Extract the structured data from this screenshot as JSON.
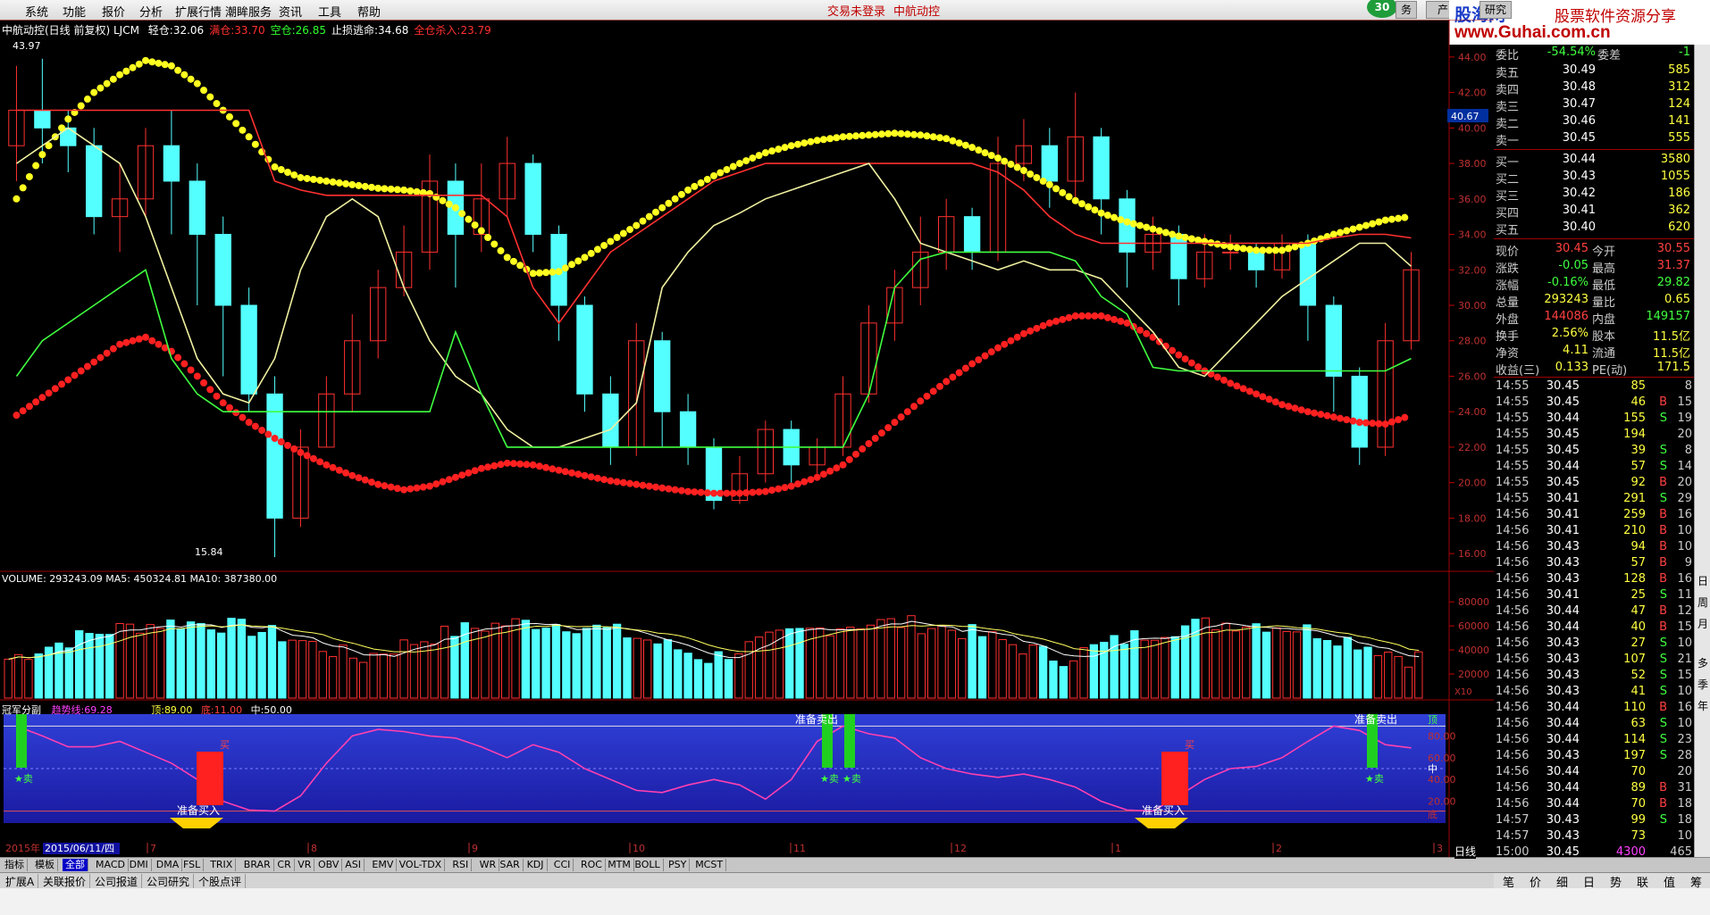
{
  "menu": [
    "系统",
    "功能",
    "报价",
    "分析",
    "扩展行情",
    "潮眸服务",
    "资讯",
    "工具",
    "帮助"
  ],
  "login_status": "交易未登录",
  "stock_name_top": "中航动控",
  "badge": "30",
  "top_buttons": [
    "务",
    "产品",
    "研究"
  ],
  "logo": {
    "name": "股海网",
    "slogan": "股票软件资源分享",
    "url": "www.Guhai.com.cn"
  },
  "chart_title": {
    "name": "中航动控(日线 前复权) LJCM",
    "items": [
      {
        "label": "轻仓:",
        "value": "32.06",
        "color": "#ffffff"
      },
      {
        "label": "满仓:",
        "value": "33.70",
        "color": "#ff3030"
      },
      {
        "label": "空仓:",
        "value": "26.85",
        "color": "#30ff30"
      },
      {
        "label": "止损逃命:",
        "value": "34.68",
        "color": "#ffffff"
      },
      {
        "label": "全仓杀入:",
        "value": "23.79",
        "color": "#ff3030"
      }
    ]
  },
  "price_axis": [
    "44.00",
    "42.00",
    "40.00",
    "38.00",
    "36.00",
    "34.00",
    "32.00",
    "30.00",
    "28.00",
    "26.00",
    "24.00",
    "22.00",
    "20.00",
    "18.00",
    "16.00"
  ],
  "price_flag": "40.67",
  "high_label": "43.97",
  "low_label": "15.84",
  "volume_title": "VOLUME: 293243.09  MA5: 450324.81  MA10: 387380.00",
  "volume_axis": [
    "80000",
    "60000",
    "40000",
    "20000"
  ],
  "volume_unit": "X10",
  "indicator_title": {
    "name": "冠军分副",
    "trend_label": "趋势线:",
    "trend": "69.28",
    "top_label": "顶:",
    "top": "89.00",
    "bottom_label": "底:",
    "bottom": "11.00",
    "mid_label": "中:",
    "mid": "50.00"
  },
  "ind_axis": [
    "顶",
    "80.00",
    "60.00",
    "中",
    "40.00",
    "20.00",
    "底"
  ],
  "ind_signals": {
    "sell": "准备卖出",
    "buy": "准备买入",
    "star_sell": "★卖",
    "buy_mark": "买"
  },
  "date_axis": {
    "year": "2015年",
    "date": "2015/06/11/四",
    "months": [
      "7",
      "8",
      "9",
      "10",
      "11",
      "12",
      "1",
      "2",
      "3"
    ]
  },
  "period": "日线",
  "tabs": [
    "指标",
    "模板",
    "全部",
    "MACD",
    "DMI",
    "DMA",
    "FSL",
    "TRIX",
    "BRAR",
    "CR",
    "VR",
    "OBV",
    "ASI",
    "EMV",
    "VOL-TDX",
    "RSI",
    "WR",
    "SAR",
    "KDJ",
    "CCI",
    "ROC",
    "MTM",
    "BOLL",
    "PSY",
    "MCST"
  ],
  "tab_active": "全部",
  "bottom_tabs": [
    "扩展A",
    "关联报价",
    "公司报道",
    "公司研究",
    "个股点评"
  ],
  "right_panel": {
    "ratio": {
      "l1": "委比",
      "v1": "-54.54%",
      "l2": "委差",
      "v2": "-1"
    },
    "asks": [
      {
        "label": "卖五",
        "price": "30.49",
        "vol": "585"
      },
      {
        "label": "卖四",
        "price": "30.48",
        "vol": "312"
      },
      {
        "label": "卖三",
        "price": "30.47",
        "vol": "124"
      },
      {
        "label": "卖二",
        "price": "30.46",
        "vol": "141"
      },
      {
        "label": "卖一",
        "price": "30.45",
        "vol": "555"
      }
    ],
    "bids": [
      {
        "label": "买一",
        "price": "30.44",
        "vol": "3580"
      },
      {
        "label": "买二",
        "price": "30.43",
        "vol": "1055"
      },
      {
        "label": "买三",
        "price": "30.42",
        "vol": "186"
      },
      {
        "label": "买四",
        "price": "30.41",
        "vol": "362"
      },
      {
        "label": "买五",
        "price": "30.40",
        "vol": "620"
      }
    ],
    "stats": [
      {
        "l1": "现价",
        "v1": "30.45",
        "c1": "#ff4040",
        "l2": "今开",
        "v2": "30.55",
        "c2": "#ff4040"
      },
      {
        "l1": "涨跌",
        "v1": "-0.05",
        "c1": "#40ff40",
        "l2": "最高",
        "v2": "31.37",
        "c2": "#ff4040"
      },
      {
        "l1": "涨幅",
        "v1": "-0.16%",
        "c1": "#40ff40",
        "l2": "最低",
        "v2": "29.82",
        "c2": "#40ff40"
      },
      {
        "l1": "总量",
        "v1": "293243",
        "c1": "#ffff40",
        "l2": "量比",
        "v2": "0.65",
        "c2": "#ffff40"
      },
      {
        "l1": "外盘",
        "v1": "144086",
        "c1": "#ff4040",
        "l2": "内盘",
        "v2": "149157",
        "c2": "#40ff40"
      },
      {
        "l1": "换手",
        "v1": "2.56%",
        "c1": "#ffff40",
        "l2": "股本",
        "v2": "11.5亿",
        "c2": "#ffff40"
      },
      {
        "l1": "净资",
        "v1": "4.11",
        "c1": "#ffff40",
        "l2": "流通",
        "v2": "11.5亿",
        "c2": "#ffff40"
      },
      {
        "l1": "收益(三)",
        "v1": "0.133",
        "c1": "#ffff40",
        "l2": "PE(动)",
        "v2": "171.5",
        "c2": "#ffff40"
      }
    ],
    "ticks": [
      {
        "t": "14:55",
        "p": "30.45",
        "v": "85",
        "s": "",
        "n": "8"
      },
      {
        "t": "14:55",
        "p": "30.45",
        "v": "46",
        "s": "B",
        "n": "15"
      },
      {
        "t": "14:55",
        "p": "30.44",
        "v": "155",
        "s": "S",
        "n": "19"
      },
      {
        "t": "14:55",
        "p": "30.45",
        "v": "194",
        "s": "",
        "n": "20"
      },
      {
        "t": "14:55",
        "p": "30.45",
        "v": "39",
        "s": "S",
        "n": "8"
      },
      {
        "t": "14:55",
        "p": "30.44",
        "v": "57",
        "s": "S",
        "n": "14"
      },
      {
        "t": "14:55",
        "p": "30.45",
        "v": "92",
        "s": "B",
        "n": "20"
      },
      {
        "t": "14:55",
        "p": "30.41",
        "v": "291",
        "s": "S",
        "n": "29"
      },
      {
        "t": "14:56",
        "p": "30.41",
        "v": "259",
        "s": "B",
        "n": "16"
      },
      {
        "t": "14:56",
        "p": "30.41",
        "v": "210",
        "s": "B",
        "n": "10"
      },
      {
        "t": "14:56",
        "p": "30.43",
        "v": "94",
        "s": "B",
        "n": "10"
      },
      {
        "t": "14:56",
        "p": "30.43",
        "v": "57",
        "s": "B",
        "n": "9"
      },
      {
        "t": "14:56",
        "p": "30.43",
        "v": "128",
        "s": "B",
        "n": "16"
      },
      {
        "t": "14:56",
        "p": "30.41",
        "v": "25",
        "s": "S",
        "n": "11"
      },
      {
        "t": "14:56",
        "p": "30.44",
        "v": "47",
        "s": "B",
        "n": "12"
      },
      {
        "t": "14:56",
        "p": "30.44",
        "v": "40",
        "s": "B",
        "n": "15"
      },
      {
        "t": "14:56",
        "p": "30.43",
        "v": "27",
        "s": "S",
        "n": "10"
      },
      {
        "t": "14:56",
        "p": "30.43",
        "v": "107",
        "s": "S",
        "n": "21"
      },
      {
        "t": "14:56",
        "p": "30.43",
        "v": "52",
        "s": "S",
        "n": "15"
      },
      {
        "t": "14:56",
        "p": "30.43",
        "v": "41",
        "s": "S",
        "n": "10"
      },
      {
        "t": "14:56",
        "p": "30.44",
        "v": "110",
        "s": "B",
        "n": "16"
      },
      {
        "t": "14:56",
        "p": "30.44",
        "v": "63",
        "s": "S",
        "n": "10"
      },
      {
        "t": "14:56",
        "p": "30.44",
        "v": "114",
        "s": "S",
        "n": "23"
      },
      {
        "t": "14:56",
        "p": "30.43",
        "v": "197",
        "s": "S",
        "n": "28"
      },
      {
        "t": "14:56",
        "p": "30.44",
        "v": "70",
        "s": "",
        "n": "20"
      },
      {
        "t": "14:56",
        "p": "30.44",
        "v": "89",
        "s": "B",
        "n": "31"
      },
      {
        "t": "14:56",
        "p": "30.44",
        "v": "70",
        "s": "B",
        "n": "18"
      },
      {
        "t": "14:57",
        "p": "30.43",
        "v": "99",
        "s": "S",
        "n": "18"
      },
      {
        "t": "14:57",
        "p": "30.43",
        "v": "73",
        "s": "",
        "n": "10"
      },
      {
        "t": "15:00",
        "p": "30.45",
        "v": "4300",
        "s": "",
        "n": "465"
      }
    ]
  },
  "right_vbar": [
    "日",
    "周",
    "月",
    "多",
    "季",
    "年"
  ],
  "right_bottom": [
    "笔",
    "价",
    "细",
    "日",
    "势",
    "联",
    "值",
    "筹"
  ],
  "chart_data": {
    "type": "candlestick",
    "y_range": [
      15,
      45
    ],
    "bull_color": "#ff3030",
    "bear_color": "#54ffff",
    "series": [
      {
        "kind": "dots",
        "color": "#ffff20",
        "values": [
          36,
          38.5,
          40.5,
          42,
          43,
          43.8,
          43.5,
          42.5,
          41,
          39.5,
          37.8,
          37.2,
          37,
          36.8,
          36.6,
          36.5,
          36.3,
          35.5,
          34.2,
          32.7,
          31.8,
          31.9,
          32.7,
          33.6,
          34.5,
          35.5,
          36.5,
          37.3,
          38,
          38.6,
          39,
          39.3,
          39.5,
          39.6,
          39.7,
          39.6,
          39.4,
          38.9,
          38.3,
          37.6,
          36.8,
          35.9,
          35.2,
          34.7,
          34.3,
          33.9,
          33.6,
          33.3,
          33.1,
          33.1,
          33.5,
          34,
          34.4,
          34.8,
          35
        ]
      },
      {
        "kind": "dots",
        "color": "#ff2020",
        "values": [
          23.8,
          24.8,
          25.8,
          26.8,
          27.8,
          28.2,
          27.4,
          26,
          24.5,
          23.4,
          22.5,
          21.7,
          21,
          20.4,
          19.9,
          19.6,
          19.8,
          20.3,
          20.8,
          21.1,
          21,
          20.7,
          20.4,
          20.1,
          19.9,
          19.7,
          19.5,
          19.4,
          19.4,
          19.5,
          19.8,
          20.3,
          21,
          22.2,
          23.4,
          24.6,
          25.7,
          26.7,
          27.6,
          28.4,
          29,
          29.4,
          29.4,
          29,
          28.2,
          27.2,
          26.3,
          25.6,
          25,
          24.4,
          24,
          23.7,
          23.4,
          23.3,
          23.8
        ]
      },
      {
        "kind": "line",
        "color": "#ff3030",
        "values": [
          41,
          41,
          41,
          41,
          41,
          41,
          41,
          41,
          41,
          41,
          37,
          36.5,
          36.2,
          36.2,
          36.2,
          36.2,
          36.2,
          36.2,
          36.2,
          35,
          31,
          29,
          31,
          33,
          34,
          35,
          36,
          37,
          37.5,
          38,
          38,
          38,
          38,
          38,
          38,
          38,
          38,
          38,
          37.5,
          36.5,
          35,
          34,
          33.5,
          33.5,
          33.5,
          33.5,
          33.5,
          33.5,
          33.5,
          33.5,
          33.5,
          33.8,
          34,
          34,
          33.8
        ]
      },
      {
        "kind": "line",
        "color": "#f0f0a0",
        "values": [
          38,
          39,
          40,
          39,
          38,
          35,
          31,
          27,
          25,
          24.5,
          27,
          32,
          35,
          36,
          35,
          31,
          28,
          26,
          25,
          23,
          22,
          22,
          22.5,
          23,
          24.5,
          31,
          33,
          34.5,
          35.2,
          36,
          36.5,
          37,
          37.5,
          38,
          36,
          33.5,
          33,
          32.5,
          32,
          32.5,
          32,
          32,
          31.5,
          30,
          28.5,
          26.5,
          26,
          27.5,
          29,
          30.5,
          31.5,
          32.5,
          33.5,
          33.5,
          32.2
        ]
      },
      {
        "kind": "line",
        "color": "#40ff40",
        "values": [
          26,
          28,
          29,
          30,
          31,
          32,
          27,
          25,
          24,
          24,
          24,
          24,
          24,
          24,
          24,
          24,
          24,
          28.5,
          25,
          22,
          22,
          22,
          22,
          22,
          22,
          22,
          22,
          22,
          22,
          22,
          22,
          22,
          22,
          25,
          31,
          32.6,
          33,
          33,
          33,
          33,
          33,
          32.5,
          30.5,
          29.5,
          26.5,
          26.3,
          26.3,
          26.3,
          26.3,
          26.3,
          26.3,
          26.3,
          26.3,
          26.3,
          27
        ]
      }
    ],
    "candles": [
      [
        39,
        41,
        43.5,
        37
      ],
      [
        41,
        40,
        43.9,
        38
      ],
      [
        40,
        39,
        41,
        37.5
      ],
      [
        39,
        35,
        40,
        34
      ],
      [
        35,
        36,
        38,
        33
      ],
      [
        36,
        39,
        40,
        35
      ],
      [
        39,
        37,
        41,
        34
      ],
      [
        37,
        34,
        38,
        30
      ],
      [
        34,
        30,
        35,
        26
      ],
      [
        30,
        25,
        31,
        24
      ],
      [
        25,
        18,
        26,
        15.8
      ],
      [
        18,
        22,
        23,
        17.5
      ],
      [
        22,
        25,
        26,
        22
      ],
      [
        25,
        28,
        29.5,
        24
      ],
      [
        28,
        31,
        32,
        27
      ],
      [
        31,
        33,
        34.5,
        30.5
      ],
      [
        33,
        37,
        38.5,
        32
      ],
      [
        37,
        34,
        38,
        31
      ],
      [
        34,
        36,
        38,
        33
      ],
      [
        36,
        38,
        39.5,
        35
      ],
      [
        38,
        34,
        38.5,
        33
      ],
      [
        34,
        30,
        34.5,
        28
      ],
      [
        30,
        25,
        30.5,
        24
      ],
      [
        25,
        22,
        26,
        21
      ],
      [
        22,
        28,
        29,
        21.5
      ],
      [
        28,
        24,
        28.5,
        22
      ],
      [
        24,
        22,
        25,
        21
      ],
      [
        22,
        19,
        22.5,
        18.5
      ],
      [
        19,
        20.5,
        21.5,
        18.8
      ],
      [
        20.5,
        23,
        23.5,
        20
      ],
      [
        23,
        21,
        23.5,
        20
      ],
      [
        21,
        22,
        22.5,
        20.5
      ],
      [
        22,
        25,
        26,
        21.5
      ],
      [
        25,
        29,
        30,
        24.5
      ],
      [
        29,
        31,
        32,
        28
      ],
      [
        31,
        33,
        35,
        30
      ],
      [
        33,
        35,
        36,
        32
      ],
      [
        35,
        33,
        35.5,
        32
      ],
      [
        33,
        38,
        39.5,
        32.5
      ],
      [
        38,
        39,
        40.5,
        37
      ],
      [
        39,
        37,
        40,
        35.5
      ],
      [
        37,
        39.5,
        42,
        36
      ],
      [
        39.5,
        36,
        40,
        34
      ],
      [
        36,
        33,
        36.5,
        31
      ],
      [
        33,
        34,
        35,
        32
      ],
      [
        34,
        31.5,
        34.5,
        30
      ],
      [
        31.5,
        33,
        34,
        31
      ],
      [
        33,
        33,
        34,
        32
      ],
      [
        33,
        32,
        33.5,
        31
      ],
      [
        32,
        33.5,
        34,
        31.5
      ],
      [
        33.5,
        30,
        34,
        28
      ],
      [
        30,
        26,
        30.5,
        24
      ],
      [
        26,
        22,
        26.5,
        21
      ],
      [
        22,
        28,
        29,
        21.5
      ],
      [
        28,
        32,
        33,
        27.5
      ]
    ]
  }
}
